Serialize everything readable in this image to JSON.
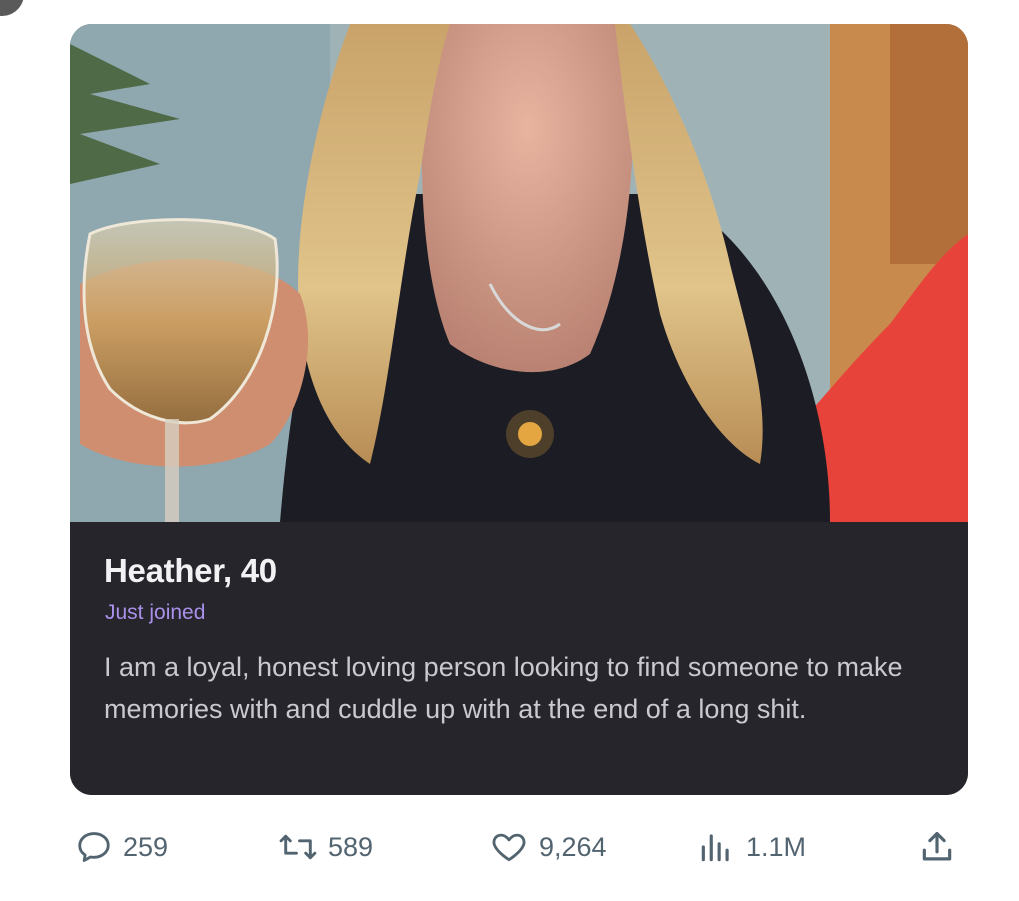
{
  "profile": {
    "name_age": "Heather, 40",
    "status": "Just joined",
    "bio": "I am a loyal, honest loving person looking to find someone to make memories with and cuddle up with at the end of a long shit.",
    "accent_color": "#a990ea"
  },
  "actions": {
    "replies": "259",
    "reposts": "589",
    "likes": "9,264",
    "views": "1.1M",
    "icon_color": "#536471"
  }
}
